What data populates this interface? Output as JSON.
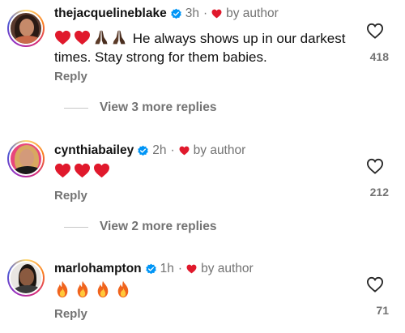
{
  "comments": [
    {
      "username": "thejacquelineblake",
      "time": "3h",
      "by_author": "by author",
      "text": "He always shows up in our darkest times. Stay strong for them babies.",
      "reply_label": "Reply",
      "likes": "418",
      "view_replies": "View 3 more replies",
      "leading_emoji": [
        "red-heart-emoji",
        "red-heart-emoji",
        "praying-hands-emoji",
        "praying-hands-emoji"
      ]
    },
    {
      "username": "cynthiabailey",
      "time": "2h",
      "by_author": "by author",
      "reply_label": "Reply",
      "likes": "212",
      "view_replies": "View 2 more replies",
      "leading_emoji": [
        "red-heart-emoji",
        "red-heart-emoji",
        "red-heart-emoji"
      ]
    },
    {
      "username": "marlohampton",
      "time": "1h",
      "by_author": "by author",
      "reply_label": "Reply",
      "likes": "71",
      "leading_emoji": [
        "fire-emoji",
        "fire-emoji",
        "fire-emoji",
        "fire-emoji"
      ]
    }
  ],
  "colors": {
    "secondary_text": "#737373",
    "verified_blue": "#0095f6",
    "author_heart_red": "#ed1c2e"
  }
}
